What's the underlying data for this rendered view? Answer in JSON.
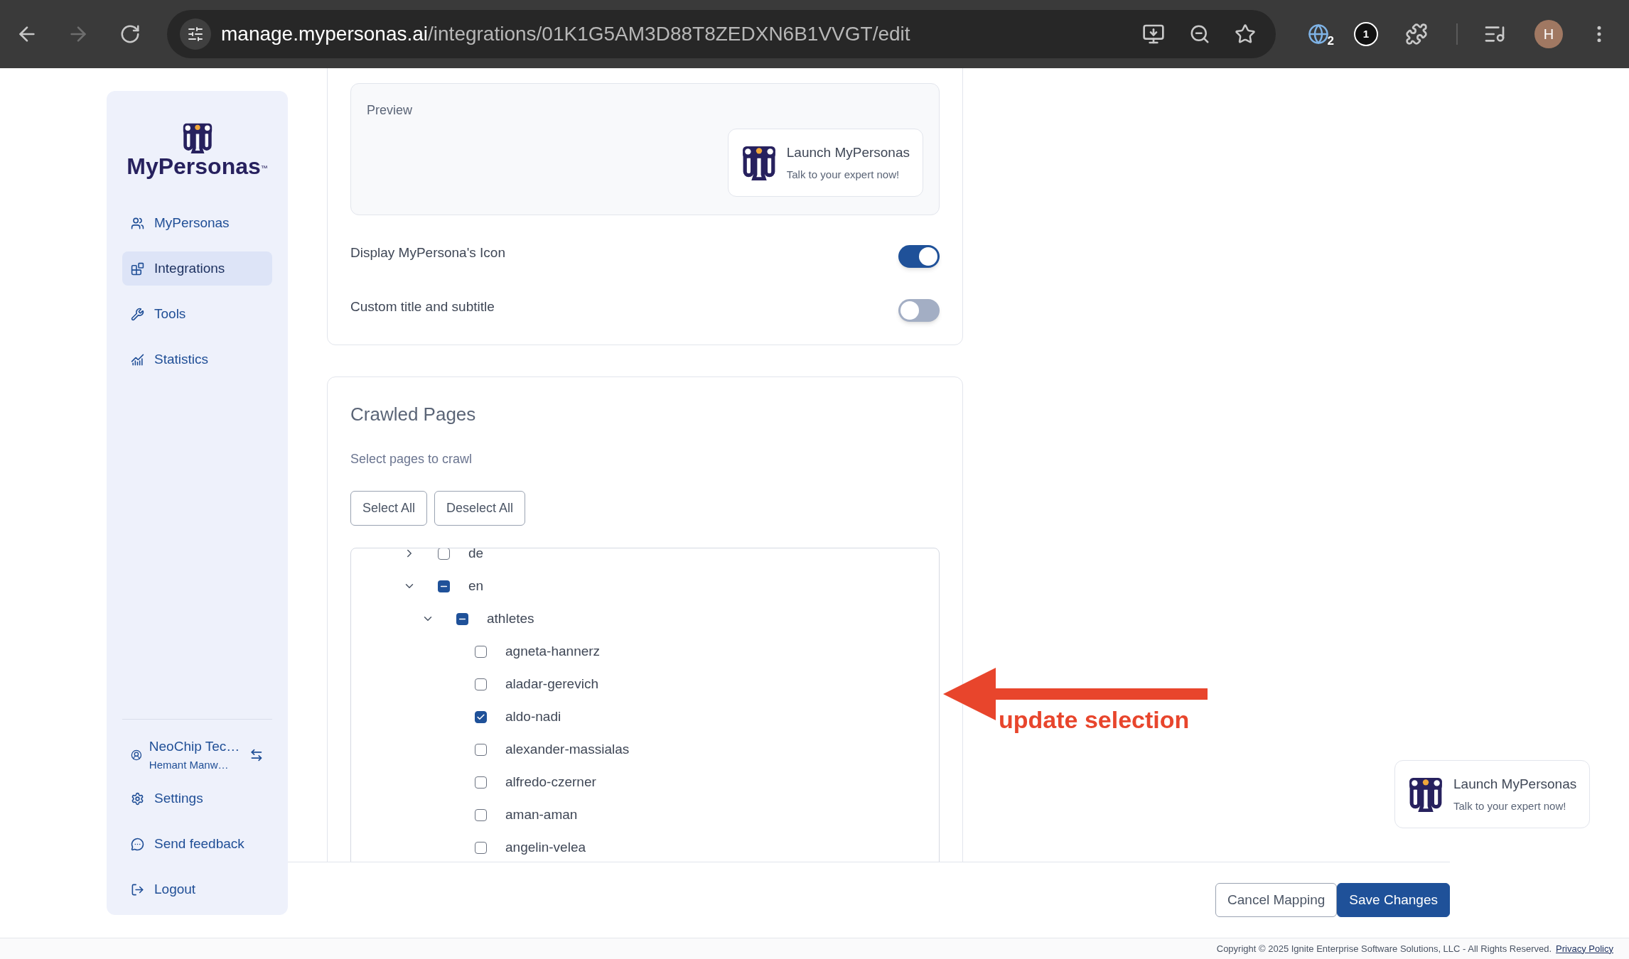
{
  "browser": {
    "address": {
      "host": "manage.mypersonas.ai",
      "path": "/integrations/01K1G5AM3D88T8ZEDXN6B1VVGT/edit"
    },
    "forward_disabled": true,
    "extension_badge": "2",
    "extension_label": "1",
    "profile_initial": "H"
  },
  "sidebar": {
    "logo": {
      "name": "MyPersonas",
      "mark": "™"
    },
    "nav": [
      {
        "label": "MyPersonas",
        "selected": false
      },
      {
        "label": "Integrations",
        "selected": true
      },
      {
        "label": "Tools",
        "selected": false
      },
      {
        "label": "Statistics",
        "selected": false
      }
    ],
    "account": {
      "name": "NeoChip Tec…",
      "user": "Hemant Manw…"
    },
    "bottom": [
      {
        "label": "Settings"
      },
      {
        "label": "Send feedback"
      },
      {
        "label": "Logout"
      }
    ]
  },
  "preview": {
    "title": "Preview",
    "widget": {
      "title": "Launch MyPersonas",
      "subtitle": "Talk to your expert now!"
    }
  },
  "toggles": [
    {
      "label": "Display MyPersona's Icon",
      "on": true
    },
    {
      "label": "Custom title and subtitle",
      "on": false
    }
  ],
  "crawled": {
    "title": "Crawled Pages",
    "subtitle": "Select pages to crawl",
    "buttons": [
      "Select All",
      "Deselect All"
    ],
    "tree": [
      {
        "label": "de",
        "expanded": false,
        "checked": false,
        "indeterminate": false
      },
      {
        "label": "en",
        "expanded": true,
        "checked": false,
        "indeterminate": true,
        "children": [
          {
            "label": "athletes",
            "expanded": true,
            "checked": false,
            "indeterminate": true,
            "children": [
              {
                "label": "agneta-hannerz",
                "checked": false
              },
              {
                "label": "aladar-gerevich",
                "checked": false
              },
              {
                "label": "aldo-nadi",
                "checked": true
              },
              {
                "label": "alexander-massialas",
                "checked": false
              },
              {
                "label": "alfredo-czerner",
                "checked": false
              },
              {
                "label": "aman-aman",
                "checked": false
              },
              {
                "label": "angelin-velea",
                "checked": false
              }
            ]
          }
        ]
      }
    ]
  },
  "annotation": {
    "text": "update selection"
  },
  "actions": [
    {
      "label": "Cancel Mapping",
      "kind": "secondary"
    },
    {
      "label": "Save Changes",
      "kind": "primary"
    }
  ],
  "floating_widget": {
    "title": "Launch MyPersonas",
    "subtitle": "Talk to your expert now!"
  },
  "footer": {
    "copyright": "Copyright © 2025 Ignite Enterprise Software Solutions, LLC - All Rights Reserved.",
    "link": "Privacy Policy"
  }
}
